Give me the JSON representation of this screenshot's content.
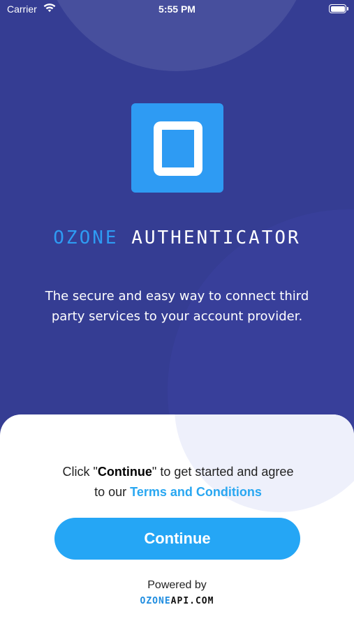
{
  "status_bar": {
    "carrier": "Carrier",
    "time": "5:55 PM",
    "icons": [
      "wifi-icon",
      "battery-icon"
    ]
  },
  "hero": {
    "logo_icon": "ozone-logo-icon",
    "brand_accent": "OZONE",
    "brand_main": "AUTHENTICATOR",
    "tagline": "The secure and easy way to connect third party services to your account provider."
  },
  "sheet": {
    "consent_prefix": "Click \"",
    "consent_bold": "Continue",
    "consent_middle": "\" to get started and agree to our ",
    "terms_link": "Terms and Conditions",
    "continue_label": "Continue",
    "powered_by": "Powered by",
    "powered_brand_accent": "OZONE",
    "powered_brand_main": "API.COM"
  },
  "colors": {
    "hero_background": "#353d93",
    "accent_blue": "#2e9bf3",
    "button_blue": "#25a6f5",
    "link_blue": "#29a7f1"
  }
}
